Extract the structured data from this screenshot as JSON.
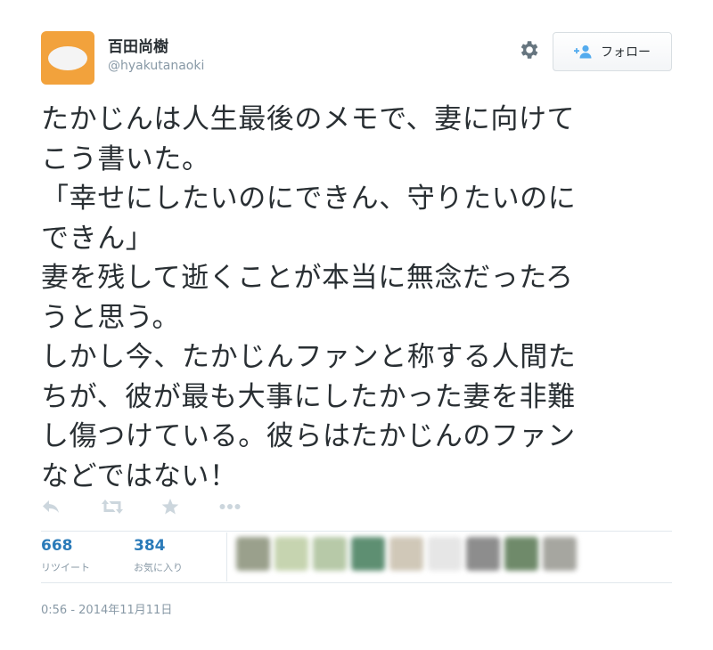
{
  "user": {
    "name": "百田尚樹",
    "screen_name": "@hyakutanaoki",
    "avatar": "default-egg-avatar",
    "avatar_color": "#F2A23C"
  },
  "follow_button": {
    "label": "フォロー",
    "icon": "follow-person-plus-icon"
  },
  "settings": {
    "icon": "gear-icon"
  },
  "tweet": {
    "text": "たかじんは人生最後のメモで、妻に向けて\nこう書いた。\n「幸せにしたいのにできん、守りたいのに\nできん」\n妻を残して逝くことが本当に無念だったろ\nうと思う。\nしかし今、たかじんファンと称する人間た\nちが、彼が最も大事にしたかった妻を非難\nし傷つけている。彼らはたかじんのファン\nなどではない！"
  },
  "actions": [
    {
      "name": "reply",
      "icon": "reply-icon"
    },
    {
      "name": "retweet",
      "icon": "retweet-icon"
    },
    {
      "name": "favorite",
      "icon": "star-icon"
    },
    {
      "name": "more",
      "icon": "more-dots-icon"
    }
  ],
  "stats": {
    "retweets": {
      "count": "668",
      "label": "リツイート"
    },
    "favorites": {
      "count": "384",
      "label": "お気に入り"
    }
  },
  "favoriter_avatars": [
    {
      "color": "#9aa08c"
    },
    {
      "color": "#c6d4b0"
    },
    {
      "color": "#b7c9a8"
    },
    {
      "color": "#5e8f72"
    },
    {
      "color": "#d0c8b8"
    },
    {
      "color": "#e6e6e6"
    },
    {
      "color": "#8d8d8d"
    },
    {
      "color": "#6f8a6a"
    },
    {
      "color": "#a6a6a0"
    }
  ],
  "timestamp": "0:56 - 2014年11月11日"
}
